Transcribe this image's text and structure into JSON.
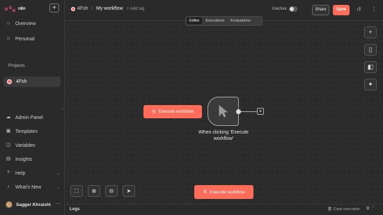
{
  "sidebar": {
    "logo_text": "n8n",
    "add_label": "+",
    "nav_top": [
      {
        "label": "Overview",
        "icon": "home-icon"
      },
      {
        "label": "Personal",
        "icon": "user-icon"
      }
    ],
    "projects_label": "Projects",
    "project": {
      "label": "4Fsh"
    },
    "nav_bottom": [
      {
        "label": "Admin Panel",
        "icon": "cloud-icon"
      },
      {
        "label": "Templates",
        "icon": "box-icon"
      },
      {
        "label": "Variables",
        "icon": "variables-icon"
      },
      {
        "label": "Insights",
        "icon": "chart-icon"
      },
      {
        "label": "Help",
        "icon": "help-icon"
      },
      {
        "label": "What's New",
        "icon": "bell-icon"
      }
    ],
    "user": {
      "name": "Sagger Khraishi"
    }
  },
  "header": {
    "project_crumb": "4Fsh",
    "separator": "/",
    "workflow_title": "My workflow",
    "add_tag": "+ Add tag",
    "status_label": "Inactive",
    "share_label": "Share",
    "save_label": "Save"
  },
  "tabs": [
    {
      "label": "Editor",
      "active": true
    },
    {
      "label": "Executions",
      "active": false
    },
    {
      "label": "Evaluations",
      "active": false
    }
  ],
  "canvas": {
    "execute_label": "Execute workflow",
    "node_label": "When clicking 'Execute workflow'",
    "bottom_execute_label": "Execute workflow"
  },
  "logs": {
    "label": "Logs",
    "clear_label": "Clear execution"
  },
  "colors": {
    "accent": "#ff6d5a",
    "background": "#2b2b2b",
    "brand": "#ea4b71"
  }
}
